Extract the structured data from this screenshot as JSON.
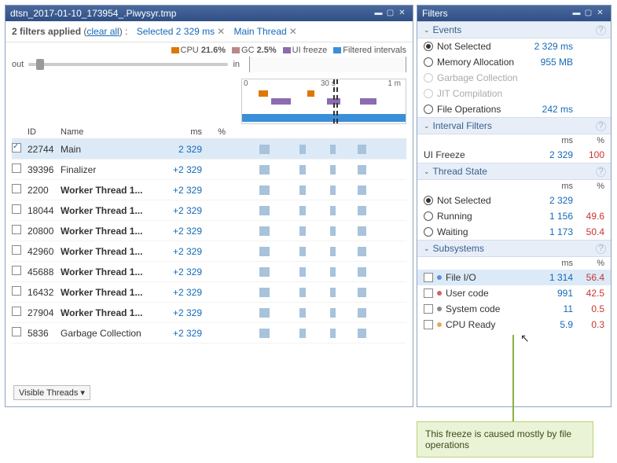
{
  "main_title": "dtsn_2017-01-10_173954_.Piwysyr.tmp",
  "filter_bar": {
    "count_text": "2 filters applied",
    "clear_text": "clear all",
    "pill1": "Selected 2 329 ms",
    "pill2": "Main Thread"
  },
  "legend": {
    "cpu_label": "CPU",
    "cpu_val": "21.6%",
    "gc_label": "GC",
    "gc_val": "2.5%",
    "ui_label": "UI freeze",
    "filt_label": "Filtered intervals"
  },
  "zoom": {
    "out": "out",
    "in": "in"
  },
  "timeline": {
    "t0": "0",
    "t30": "30 s",
    "t60": "1 m"
  },
  "thead": {
    "id": "ID",
    "name": "Name",
    "ms": "ms",
    "pct": "%"
  },
  "threads": [
    {
      "chk": true,
      "id": "22744",
      "name": "Main",
      "bold": false,
      "ms": "2 329"
    },
    {
      "chk": false,
      "id": "39396",
      "name": "Finalizer",
      "bold": false,
      "ms": "+2 329"
    },
    {
      "chk": false,
      "id": "2200",
      "name": "Worker Thread 1...",
      "bold": true,
      "ms": "+2 329"
    },
    {
      "chk": false,
      "id": "18044",
      "name": "Worker Thread 1...",
      "bold": true,
      "ms": "+2 329"
    },
    {
      "chk": false,
      "id": "20800",
      "name": "Worker Thread 1...",
      "bold": true,
      "ms": "+2 329"
    },
    {
      "chk": false,
      "id": "42960",
      "name": "Worker Thread 1...",
      "bold": true,
      "ms": "+2 329"
    },
    {
      "chk": false,
      "id": "45688",
      "name": "Worker Thread 1...",
      "bold": true,
      "ms": "+2 329"
    },
    {
      "chk": false,
      "id": "16432",
      "name": "Worker Thread 1...",
      "bold": true,
      "ms": "+2 329"
    },
    {
      "chk": false,
      "id": "27904",
      "name": "Worker Thread 1...",
      "bold": true,
      "ms": "+2 329"
    },
    {
      "chk": false,
      "id": "5836",
      "name": "Garbage Collection",
      "bold": false,
      "ms": "+2 329"
    }
  ],
  "visible_threads": "Visible Threads",
  "filters_title": "Filters",
  "sections": {
    "events": "Events",
    "interval": "Interval Filters",
    "thread_state": "Thread State",
    "subsystems": "Subsystems"
  },
  "sub_hdr": {
    "ms": "ms",
    "pct": "%"
  },
  "events": {
    "not_selected": {
      "label": "Not Selected",
      "val": "2 329 ms"
    },
    "mem": {
      "label": "Memory Allocation",
      "val": "955 MB"
    },
    "gc": {
      "label": "Garbage Collection"
    },
    "jit": {
      "label": "JIT Compilation"
    },
    "file": {
      "label": "File Operations",
      "val": "242 ms"
    }
  },
  "interval": {
    "ui_freeze": {
      "label": "UI Freeze",
      "ms": "2 329",
      "pct": "100"
    }
  },
  "thread_state": {
    "not_selected": {
      "label": "Not Selected",
      "ms": "2 329"
    },
    "running": {
      "label": "Running",
      "ms": "1 156",
      "pct": "49.6"
    },
    "waiting": {
      "label": "Waiting",
      "ms": "1 173",
      "pct": "50.4"
    }
  },
  "subsystems": [
    {
      "label": "File I/O",
      "color": "#5b91d6",
      "ms": "1 314",
      "pct": "56.4",
      "sel": true
    },
    {
      "label": "User code",
      "color": "#d06464",
      "ms": "991",
      "pct": "42.5"
    },
    {
      "label": "System code",
      "color": "#888",
      "ms": "11",
      "pct": "0.5"
    },
    {
      "label": "CPU Ready",
      "color": "#e6a95b",
      "ms": "5.9",
      "pct": "0.3"
    }
  ],
  "callout": "This freeze is caused mostly by file operations",
  "chart_data": {
    "type": "table",
    "title": "Subsystems breakdown during UI Freeze (2329 ms)",
    "categories": [
      "File I/O",
      "User code",
      "System code",
      "CPU Ready"
    ],
    "series": [
      {
        "name": "ms",
        "values": [
          1314,
          991,
          11,
          5.9
        ]
      },
      {
        "name": "pct",
        "values": [
          56.4,
          42.5,
          0.5,
          0.3
        ]
      }
    ]
  }
}
